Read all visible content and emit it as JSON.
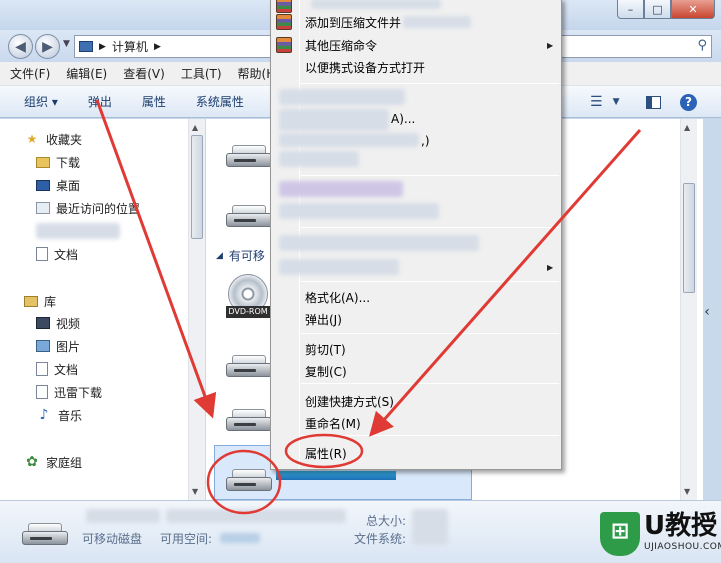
{
  "window": {
    "address_path": "计算机",
    "minimize_label": "–",
    "maximize_label": "□",
    "close_label": "✕"
  },
  "menubar": {
    "items": [
      "文件(F)",
      "编辑(E)",
      "查看(V)",
      "工具(T)",
      "帮助(H)"
    ]
  },
  "commandbar": {
    "items": [
      "组织 ▾",
      "弹出",
      "属性",
      "系统属性"
    ]
  },
  "navpane": {
    "favorites_label": "收藏夹",
    "downloads_label": "下载",
    "desktop_label": "桌面",
    "recent_label": "最近访问的位置",
    "documents_label": "文档",
    "libraries_label": "库",
    "videos_label": "视频",
    "pictures_label": "图片",
    "lib_documents_label": "文档",
    "xunlei_label": "迅雷下载",
    "music_label": "音乐",
    "homegroup_label": "家庭组"
  },
  "content": {
    "group_header": "有可移",
    "dvd_label": "DVD-ROM"
  },
  "context_menu": {
    "add_to_archive": "添加到压缩文件并",
    "other_compress": "其他压缩命令",
    "open_portable": "以便携式设备方式打开",
    "blurred_a": "A)...",
    "blurred_b": ",)",
    "format": "格式化(A)...",
    "eject": "弹出(J)",
    "cut": "剪切(T)",
    "copy": "复制(C)",
    "create_shortcut": "创建快捷方式(S)",
    "rename": "重命名(M)",
    "properties": "属性(R)"
  },
  "details": {
    "type_label": "可移动磁盘",
    "free_label": "可用空间:",
    "total_label": "总大小:",
    "fs_label": "文件系统:"
  },
  "watermark": {
    "brand": "U教授",
    "domain": "UJIAOSHOU.COM"
  },
  "colors": {
    "annotation_red": "#e03a35",
    "highlight_blue": "#1b6fb4"
  }
}
